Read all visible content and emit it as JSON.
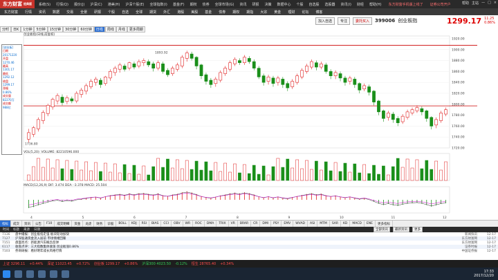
{
  "app": {
    "logo": "东方财富",
    "logo_sub": "经典版",
    "ad_text": "东方财富手机版上线了",
    "ad_text2": "证券公司开户"
  },
  "menu": [
    "系统(S)",
    "行情(Q)",
    "报价(J)",
    "沪深(C)",
    "港美(H)",
    "沪深个股(E)",
    "全球指数(I)",
    "基金(F)",
    "期权",
    "债券",
    "全球市场(G)",
    "资讯",
    "研报",
    "决策",
    "数据中心",
    "个股",
    "自选股",
    "选股器",
    "资讯(I)",
    "财经",
    "帮助(H)"
  ],
  "window_controls": [
    "帮助",
    "主站",
    "—",
    "□",
    "×"
  ],
  "toolbar2": [
    "东方财富",
    "行情",
    "资讯",
    "数据",
    "交易",
    "全景",
    "研报",
    "个股",
    "自选",
    "全球",
    "期货",
    "外汇",
    "港股",
    "美股",
    "基金",
    "债券",
    "期权",
    "期指",
    "大宗",
    "黄金",
    "理财",
    "论坛",
    "博客"
  ],
  "header": {
    "add_btn": "加入自选",
    "watch_btn": "专注",
    "alert_btn": "委托买入",
    "code": "399006",
    "name": "创业板指",
    "price": "1299.17",
    "chg1": "11.25",
    "chg2": "0.86%"
  },
  "periods": [
    "分时",
    "日K",
    "1分钟",
    "5分钟",
    "15分钟",
    "30分钟",
    "60分钟",
    "日线",
    "周线",
    "月线",
    "更多周期"
  ],
  "period_active": 7,
  "chart_title": "创业板指(日线,前复权)",
  "left_panel": [
    "[创业板]",
    "日期",
    "20171220",
    "开盘",
    "1270.46",
    "最高",
    "1301.17",
    "最低",
    "1292.12",
    "收盘",
    "1299.17",
    "涨幅",
    "0.86%",
    "成交量",
    "82270万",
    "成交额",
    "988亿"
  ],
  "chart_data": [
    {
      "type": "candlestick",
      "title": "创业板指(日线,前复权)",
      "y_axis": [
        "1920.00",
        "1900.00",
        "1880.00",
        "1860.00",
        "1840.00",
        "1820.00",
        "1800.00",
        "1780.00",
        "1760.00",
        "1740.00",
        "1720.00"
      ],
      "annotations": [
        "1893.92",
        "1736.80"
      ],
      "ylim": [
        1720,
        1925
      ],
      "candles": [
        [
          1736,
          1748,
          1730,
          1755
        ],
        [
          1745,
          1757,
          1740,
          1760
        ],
        [
          1755,
          1772,
          1750,
          1776
        ],
        [
          1770,
          1785,
          1764,
          1789
        ],
        [
          1783,
          1798,
          1778,
          1801
        ],
        [
          1795,
          1809,
          1790,
          1812
        ],
        [
          1806,
          1816,
          1800,
          1820
        ],
        [
          1813,
          1803,
          1798,
          1818
        ],
        [
          1805,
          1812,
          1800,
          1816
        ],
        [
          1810,
          1806,
          1802,
          1814
        ],
        [
          1806,
          1820,
          1802,
          1824
        ],
        [
          1818,
          1826,
          1812,
          1830
        ],
        [
          1824,
          1834,
          1818,
          1838
        ],
        [
          1832,
          1842,
          1828,
          1846
        ],
        [
          1840,
          1846,
          1834,
          1850
        ],
        [
          1844,
          1836,
          1830,
          1848
        ],
        [
          1838,
          1850,
          1834,
          1852
        ],
        [
          1848,
          1860,
          1843,
          1864
        ],
        [
          1858,
          1866,
          1852,
          1870
        ],
        [
          1864,
          1872,
          1858,
          1876
        ],
        [
          1870,
          1864,
          1860,
          1874
        ],
        [
          1866,
          1876,
          1862,
          1878
        ],
        [
          1874,
          1868,
          1864,
          1878
        ],
        [
          1870,
          1878,
          1866,
          1882
        ],
        [
          1876,
          1880,
          1870,
          1884
        ],
        [
          1878,
          1872,
          1868,
          1882
        ],
        [
          1874,
          1866,
          1860,
          1878
        ],
        [
          1866,
          1876,
          1862,
          1880
        ],
        [
          1874,
          1860,
          1856,
          1878
        ],
        [
          1862,
          1854,
          1850,
          1866
        ],
        [
          1856,
          1866,
          1852,
          1870
        ],
        [
          1864,
          1872,
          1860,
          1876
        ],
        [
          1870,
          1886,
          1866,
          1890
        ],
        [
          1884,
          1894,
          1878,
          1898
        ],
        [
          1892,
          1884,
          1880,
          1896
        ],
        [
          1886,
          1870,
          1864,
          1888
        ],
        [
          1872,
          1852,
          1846,
          1874
        ],
        [
          1854,
          1842,
          1836,
          1858
        ],
        [
          1844,
          1836,
          1830,
          1848
        ],
        [
          1838,
          1846,
          1832,
          1850
        ],
        [
          1844,
          1858,
          1840,
          1862
        ],
        [
          1856,
          1866,
          1852,
          1870
        ],
        [
          1864,
          1876,
          1860,
          1880
        ],
        [
          1874,
          1882,
          1870,
          1886
        ],
        [
          1880,
          1876,
          1872,
          1884
        ],
        [
          1876,
          1886,
          1872,
          1890
        ],
        [
          1884,
          1878,
          1874,
          1888
        ],
        [
          1878,
          1866,
          1862,
          1882
        ],
        [
          1866,
          1850,
          1846,
          1870
        ],
        [
          1852,
          1840,
          1834,
          1856
        ],
        [
          1842,
          1850,
          1836,
          1854
        ],
        [
          1848,
          1838,
          1832,
          1852
        ],
        [
          1840,
          1848,
          1834,
          1852
        ],
        [
          1846,
          1836,
          1830,
          1850
        ],
        [
          1838,
          1830,
          1824,
          1842
        ],
        [
          1832,
          1842,
          1828,
          1846
        ],
        [
          1840,
          1852,
          1836,
          1856
        ],
        [
          1850,
          1862,
          1846,
          1866
        ],
        [
          1860,
          1870,
          1856,
          1874
        ],
        [
          1868,
          1878,
          1864,
          1882
        ],
        [
          1876,
          1868,
          1862,
          1880
        ],
        [
          1868,
          1874,
          1864,
          1878
        ],
        [
          1872,
          1860,
          1856,
          1876
        ],
        [
          1860,
          1852,
          1846,
          1864
        ],
        [
          1852,
          1858,
          1846,
          1862
        ],
        [
          1856,
          1848,
          1842,
          1860
        ],
        [
          1848,
          1840,
          1834,
          1852
        ],
        [
          1842,
          1848,
          1836,
          1852
        ],
        [
          1846,
          1836,
          1830,
          1850
        ],
        [
          1838,
          1826,
          1820,
          1840
        ],
        [
          1828,
          1834,
          1824,
          1838
        ],
        [
          1832,
          1822,
          1816,
          1836
        ],
        [
          1824,
          1804,
          1798,
          1826
        ],
        [
          1806,
          1786,
          1780,
          1808
        ],
        [
          1788,
          1774,
          1768,
          1790
        ],
        [
          1776,
          1784,
          1770,
          1788
        ],
        [
          1782,
          1772,
          1766,
          1786
        ],
        [
          1774,
          1766,
          1760,
          1778
        ],
        [
          1768,
          1778,
          1764,
          1782
        ],
        [
          1776,
          1786,
          1772,
          1790
        ],
        [
          1784,
          1790,
          1780,
          1794
        ],
        [
          1788,
          1794,
          1784,
          1798
        ],
        [
          1792,
          1786,
          1780,
          1796
        ],
        [
          1788,
          1774,
          1768,
          1790
        ],
        [
          1776,
          1760,
          1754,
          1778
        ],
        [
          1762,
          1772,
          1756,
          1776
        ],
        [
          1770,
          1784,
          1766,
          1788
        ],
        [
          1782,
          1790,
          1778,
          1794
        ]
      ],
      "volume_label": "VOL(5,20): VOLUME: 82210596.000",
      "macd_label": "MACD(12,26,9) DIF: 3.474 DEA: -3.378 MACD: 25.504"
    }
  ],
  "date_axis": [
    "4",
    "5",
    "6",
    "7",
    "8",
    "9",
    "10",
    "11",
    "12"
  ],
  "bottom_tabs": [
    "指标",
    "成交",
    "资讯",
    "公告",
    "F10",
    "成交明细",
    "资金",
    "龙虎",
    "财务",
    "诊股",
    "BOLL",
    "KDJ",
    "RSI",
    "BIAS",
    "CCI",
    "OBV",
    "WR",
    "ROC",
    "DMA",
    "TRIX",
    "VR",
    "BRAR",
    "CR",
    "DMI",
    "PSY",
    "EMV",
    "WVAD",
    "ASI",
    "MTM",
    "SAR",
    "KD",
    "MACD",
    "ENE",
    "更多指标"
  ],
  "bottom_active": 0,
  "news_header": [
    "时间",
    "标题",
    "来源",
    "日期"
  ],
  "news": [
    [
      "7136",
      "盘中播报：创业板指走强 板块轮动加快",
      "新闻快讯",
      "12-17"
    ],
    [
      "7127",
      "沪深股通资金流入居前 市场情绪回暖",
      "东方财富网",
      "12-17"
    ],
    [
      "7151",
      "盘面亮点：新能源汽车概念反弹",
      "东方财富网",
      "12-17"
    ],
    [
      "6117",
      "收盘点评：三大指数集体收涨 创业板涨0.86%",
      "证券时报",
      "12-17"
    ],
    [
      "7103",
      "券商研报：看好明年成长风格行情",
      "中国证券报",
      "12-17"
    ]
  ],
  "news_buttons": [
    "全部资讯",
    "最新资讯",
    "更多"
  ],
  "ticker": [
    {
      "t": "上证 3296.11",
      "c": "r"
    },
    {
      "t": "+0.44%",
      "c": "r"
    },
    {
      "t": "深证 11023.45",
      "c": "r"
    },
    {
      "t": "+0.72%",
      "c": "r"
    },
    {
      "t": "创业板 1299.17",
      "c": "r"
    },
    {
      "t": "+0.86%",
      "c": "r"
    },
    {
      "t": "沪深300 4023.50",
      "c": "g"
    },
    {
      "t": "-0.12%",
      "c": "g"
    },
    {
      "t": "恒生 28765.40",
      "c": "r"
    },
    {
      "t": "+0.34%",
      "c": "r"
    }
  ],
  "clock": {
    "time": "17:33",
    "date": "2017/12/20"
  }
}
